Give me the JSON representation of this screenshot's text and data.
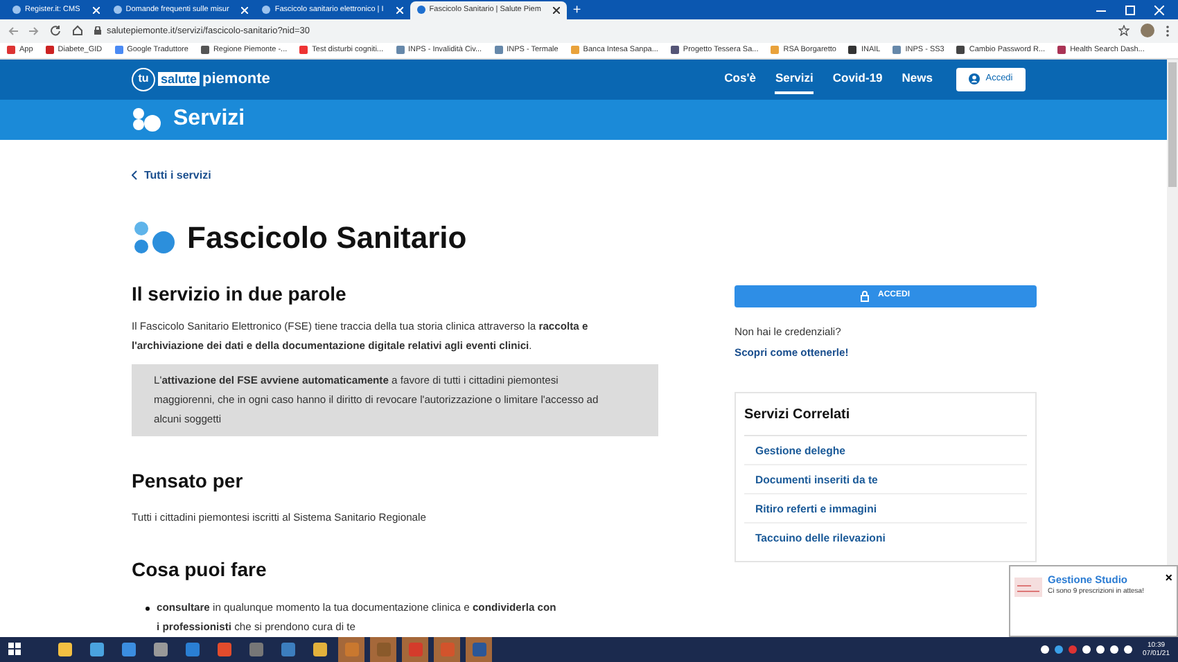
{
  "browser": {
    "tabs": [
      {
        "title": "Register.it: CMS",
        "selected": false
      },
      {
        "title": "Domande frequenti sulle misur",
        "selected": false
      },
      {
        "title": "Fascicolo sanitario elettronico | I",
        "selected": false
      },
      {
        "title": "Fascicolo Sanitario | Salute Piem",
        "selected": true
      }
    ],
    "new_tab": "+",
    "url": "salutepiemonte.it/servizi/fascicolo-sanitario?nid=30",
    "bookmarks": [
      "App",
      "Diabete_GID",
      "Google Traduttore",
      "Regione Piemonte -...",
      "Test disturbi cogniti...",
      "INPS - Invalidità Civ...",
      "INPS - Termale",
      "Banca Intesa Sanpa...",
      "Progetto Tessera Sa...",
      "RSA Borgaretto",
      "INAIL",
      "INPS - SS3",
      "Cambio Password R...",
      "Health Search Dash..."
    ]
  },
  "site": {
    "logo": {
      "badge": "tu",
      "brand": "salute",
      "name": "piemonte"
    },
    "nav": [
      {
        "label": "Cos'è",
        "selected": false
      },
      {
        "label": "Servizi",
        "selected": true
      },
      {
        "label": "Covid-19",
        "selected": false
      },
      {
        "label": "News",
        "selected": false
      }
    ],
    "login": "Accedi",
    "section": "Servizi"
  },
  "page": {
    "back": "Tutti i servizi",
    "title": "Fascicolo Sanitario",
    "intro_heading": "Il servizio in due parole",
    "intro": "Il Fascicolo Sanitario Elettronico (FSE) tiene traccia della tua storia clinica attraverso la **raccolta e l'archiviazione dei dati e della documentazione digitale relativi agli eventi clinici**.",
    "note": "L'**attivazione del FSE avviene automaticamente** a favore di tutti i cittadini piemontesi maggiorenni, che in ogni caso hanno il diritto di revocare l'autorizzazione o limitare l'accesso ad alcuni soggetti",
    "for_heading": "Pensato per",
    "for_text": "Tutti i cittadini piemontesi iscritti al Sistema Sanitario Regionale",
    "do_heading": "Cosa puoi fare",
    "do_items": [
      "**consultare** in qualunque momento la tua documentazione clinica e **condividerla con i professionisti** che si prendono cura di te"
    ],
    "access_button": "ACCEDI",
    "no_credentials": "Non hai le credenziali?",
    "discover_link": "Scopri come ottenerle!",
    "related": {
      "title": "Servizi Correlati",
      "items": [
        "Gestione deleghe",
        "Documenti inseriti da te",
        "Ritiro referti e immagini",
        "Taccuino delle rilevazioni"
      ]
    }
  },
  "notification": {
    "title": "Gestione Studio",
    "text": "Ci sono 9 prescrizioni in attesa!",
    "close": "×"
  },
  "taskbar": {
    "time": "10:39",
    "date": "07/01/21"
  }
}
